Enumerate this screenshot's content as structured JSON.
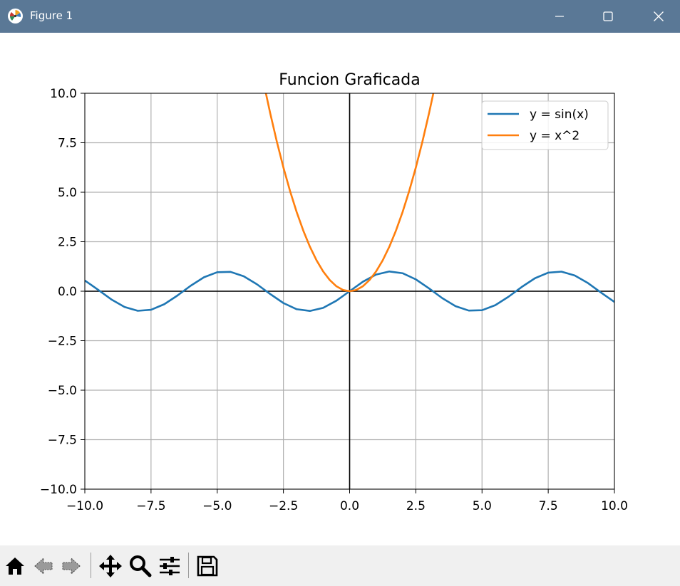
{
  "window": {
    "title": "Figure 1",
    "titlebar_color": "#5a7896",
    "controls": [
      "minimize-icon",
      "maximize-icon",
      "close-icon"
    ]
  },
  "toolbar": {
    "buttons": [
      "home-icon",
      "back-icon",
      "forward-icon",
      "pan-icon",
      "zoom-icon",
      "configure-subplots-icon",
      "save-icon"
    ]
  },
  "chart_data": {
    "type": "line",
    "title": "Funcion Graficada",
    "xlabel": "",
    "ylabel": "",
    "xlim": [
      -10,
      10
    ],
    "ylim": [
      -10,
      10
    ],
    "xticks": [
      -10,
      -7.5,
      -5,
      -2.5,
      0,
      2.5,
      5,
      7.5,
      10
    ],
    "yticks": [
      -10,
      -7.5,
      -5,
      -2.5,
      0,
      2.5,
      5,
      7.5,
      10
    ],
    "xtick_labels": [
      "−10.0",
      "−7.5",
      "−5.0",
      "−2.5",
      "0.0",
      "2.5",
      "5.0",
      "7.5",
      "10.0"
    ],
    "ytick_labels": [
      "−10.0",
      "−7.5",
      "−5.0",
      "−2.5",
      "0.0",
      "2.5",
      "5.0",
      "7.5",
      "10.0"
    ],
    "grid": true,
    "legend_position": "top-right",
    "reference_lines": {
      "horizontal_y": 0,
      "vertical_x": 0,
      "color": "#000000"
    },
    "series": [
      {
        "name": "y = sin(x)",
        "color": "#1f77b4",
        "x": [
          -10,
          -9.5,
          -9,
          -8.5,
          -8,
          -7.5,
          -7,
          -6.5,
          -6,
          -5.5,
          -5,
          -4.5,
          -4,
          -3.5,
          -3,
          -2.5,
          -2,
          -1.5,
          -1,
          -0.5,
          0,
          0.5,
          1,
          1.5,
          2,
          2.5,
          3,
          3.5,
          4,
          4.5,
          5,
          5.5,
          6,
          6.5,
          7,
          7.5,
          8,
          8.5,
          9,
          9.5,
          10
        ],
        "y": [
          0.544,
          0.075,
          -0.412,
          -0.798,
          -0.989,
          -0.938,
          -0.657,
          -0.215,
          0.279,
          0.706,
          0.959,
          0.978,
          0.757,
          0.351,
          -0.141,
          -0.598,
          -0.909,
          -0.997,
          -0.841,
          -0.479,
          0,
          0.479,
          0.841,
          0.997,
          0.909,
          0.598,
          0.141,
          -0.351,
          -0.757,
          -0.978,
          -0.959,
          -0.706,
          -0.279,
          0.215,
          0.657,
          0.938,
          0.989,
          0.798,
          0.412,
          -0.075,
          -0.544
        ]
      },
      {
        "name": "y = x^2",
        "color": "#ff7f0e",
        "x": [
          -3.162,
          -3,
          -2.75,
          -2.5,
          -2.25,
          -2,
          -1.75,
          -1.5,
          -1.25,
          -1,
          -0.75,
          -0.5,
          -0.25,
          0,
          0.25,
          0.5,
          0.75,
          1,
          1.25,
          1.5,
          1.75,
          2,
          2.25,
          2.5,
          2.75,
          3,
          3.162
        ],
        "y": [
          10,
          9,
          7.563,
          6.25,
          5.063,
          4,
          3.063,
          2.25,
          1.563,
          1,
          0.563,
          0.25,
          0.063,
          0,
          0.063,
          0.25,
          0.563,
          1,
          1.563,
          2.25,
          3.063,
          4,
          5.063,
          6.25,
          7.563,
          9,
          10
        ]
      }
    ]
  }
}
